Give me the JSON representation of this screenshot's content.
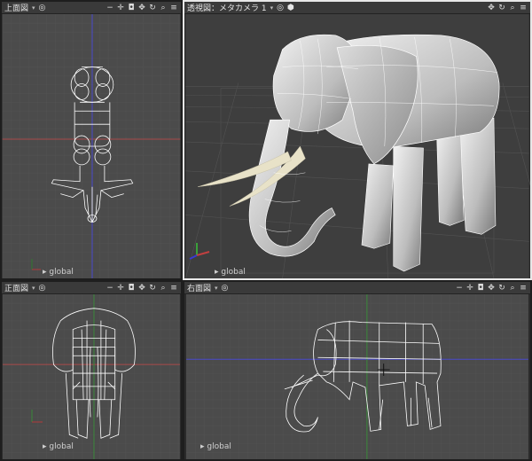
{
  "viewports": {
    "top": {
      "title": "上面図",
      "coord_label": "global"
    },
    "perspective": {
      "title": "透視図：メタカメラ 1",
      "coord_label": "global"
    },
    "front": {
      "title": "正面図",
      "coord_label": "global"
    },
    "right": {
      "title": "右面図",
      "coord_label": "global"
    }
  },
  "icons": {
    "header_tools": [
      "target-icon",
      "zoom-out-icon",
      "pan-icon",
      "camera-icon",
      "move-icon",
      "rotate-icon",
      "zoom-icon",
      "menu-icon"
    ],
    "persp_tools": [
      "target-icon",
      "cube-icon",
      "move-icon",
      "rotate-icon",
      "zoom-icon",
      "menu-icon"
    ]
  },
  "colors": {
    "background": "#4a4a4a",
    "grid": "#5a5a5a",
    "x_axis": "#b03a3a",
    "y_axis": "#3a7a3a",
    "z_axis": "#3a3ad0",
    "wireframe": "#ffffff",
    "active_border": "#e8e8e8",
    "tusk": "#e8e2c8"
  }
}
